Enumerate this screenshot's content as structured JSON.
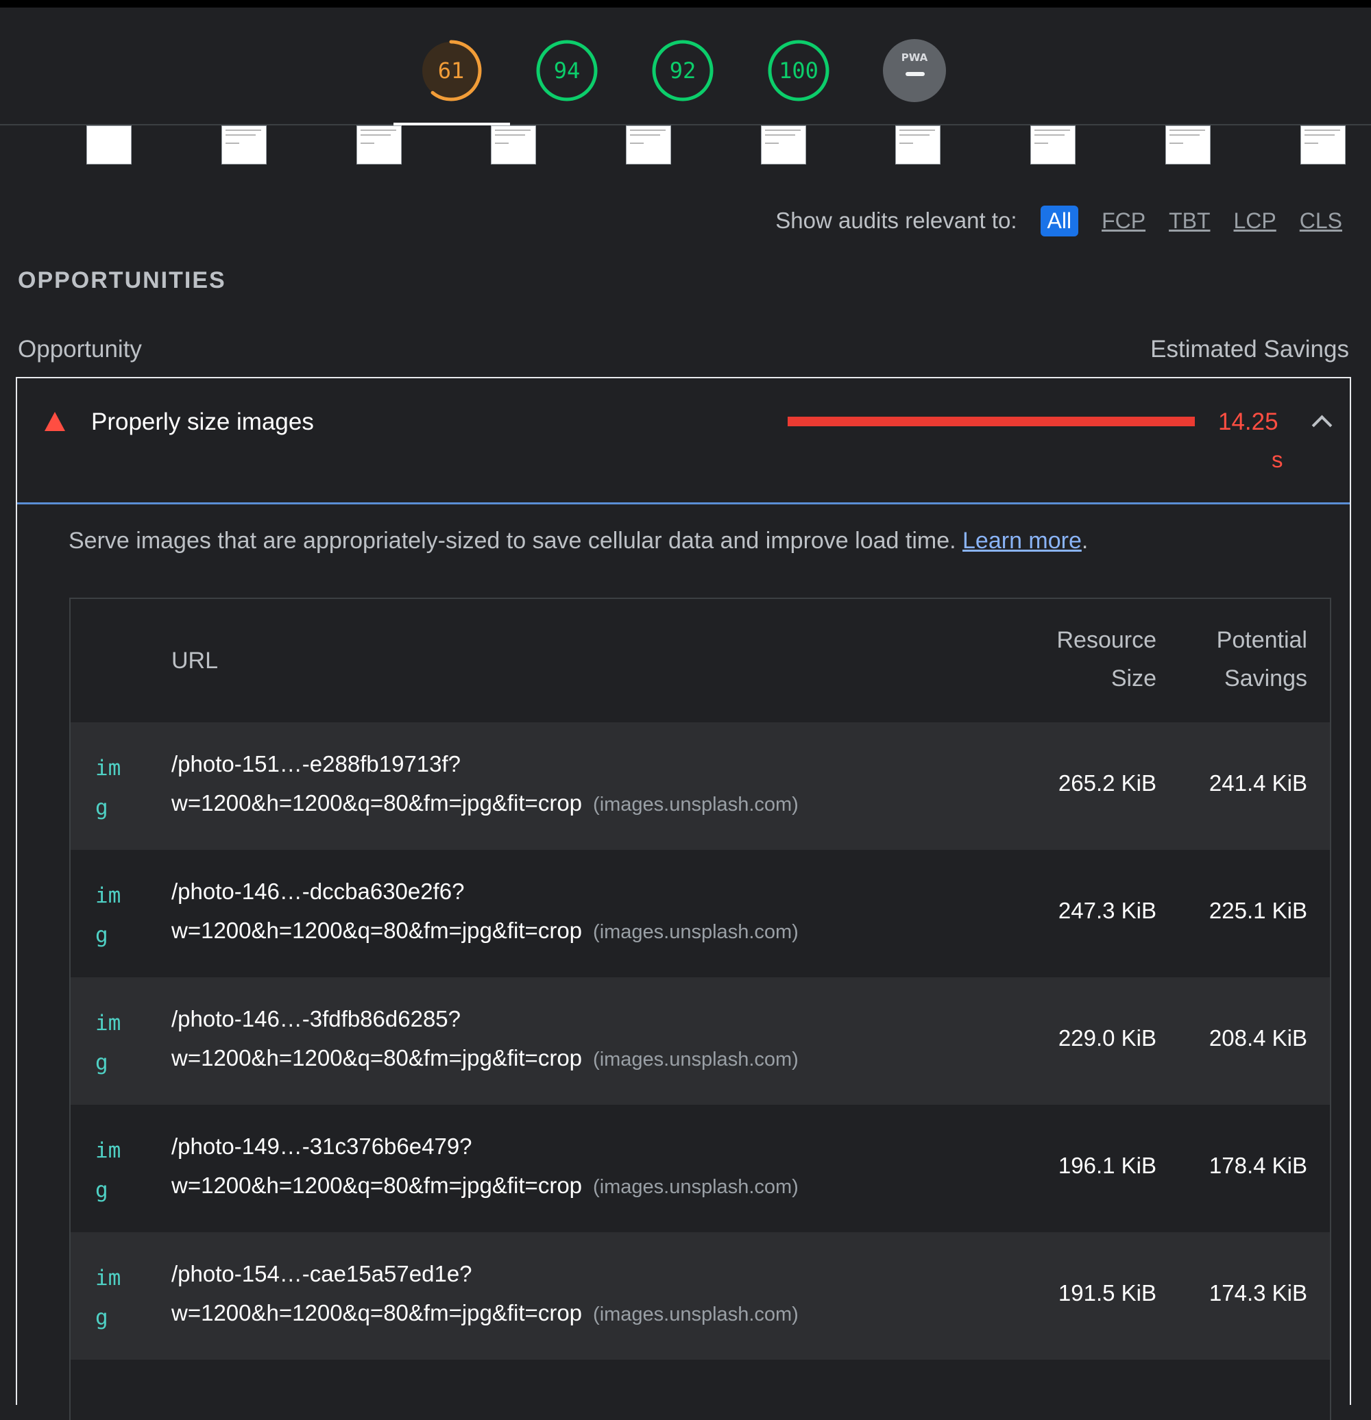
{
  "gauges": [
    {
      "score": "61",
      "color": "#f29d38",
      "fraction": 0.61
    },
    {
      "score": "94",
      "color": "#0cce6b",
      "fraction": 1.0
    },
    {
      "score": "92",
      "color": "#0cce6b",
      "fraction": 1.0
    },
    {
      "score": "100",
      "color": "#0cce6b",
      "fraction": 1.0
    },
    {
      "score": "PWA",
      "color": "#5f6368",
      "fraction": 0
    }
  ],
  "filter": {
    "label": "Show audits relevant to:",
    "chips": [
      "All",
      "FCP",
      "TBT",
      "LCP",
      "CLS"
    ],
    "active": "All"
  },
  "section": {
    "title": "OPPORTUNITIES",
    "col_left": "Opportunity",
    "col_right": "Estimated Savings"
  },
  "audit": {
    "title": "Properly size images",
    "savings_value": "14.25",
    "savings_unit": "s",
    "description": "Serve images that are appropriately-sized to save cellular data and improve load time.",
    "learn_more": "Learn more",
    "period": "."
  },
  "table": {
    "headers": {
      "url": "URL",
      "resource_size_1": "Resource",
      "resource_size_2": "Size",
      "potential_savings_1": "Potential",
      "potential_savings_2": "Savings"
    },
    "rows": [
      {
        "type1": "im",
        "type2": "g",
        "url1": "/photo-151…-e288fb19713f?",
        "url2": "w=1200&h=1200&q=80&fm=jpg&fit=crop",
        "host": "(images.unsplash.com)",
        "size": "265.2 KiB",
        "savings": "241.4 KiB"
      },
      {
        "type1": "im",
        "type2": "g",
        "url1": "/photo-146…-dccba630e2f6?",
        "url2": "w=1200&h=1200&q=80&fm=jpg&fit=crop",
        "host": "(images.unsplash.com)",
        "size": "247.3 KiB",
        "savings": "225.1 KiB"
      },
      {
        "type1": "im",
        "type2": "g",
        "url1": "/photo-146…-3fdfb86d6285?",
        "url2": "w=1200&h=1200&q=80&fm=jpg&fit=crop",
        "host": "(images.unsplash.com)",
        "size": "229.0 KiB",
        "savings": "208.4 KiB"
      },
      {
        "type1": "im",
        "type2": "g",
        "url1": "/photo-149…-31c376b6e479?",
        "url2": "w=1200&h=1200&q=80&fm=jpg&fit=crop",
        "host": "(images.unsplash.com)",
        "size": "196.1 KiB",
        "savings": "178.4 KiB"
      },
      {
        "type1": "im",
        "type2": "g",
        "url1": "/photo-154…-cae15a57ed1e?",
        "url2": "w=1200&h=1200&q=80&fm=jpg&fit=crop",
        "host": "(images.unsplash.com)",
        "size": "191.5 KiB",
        "savings": "174.3 KiB"
      }
    ]
  }
}
